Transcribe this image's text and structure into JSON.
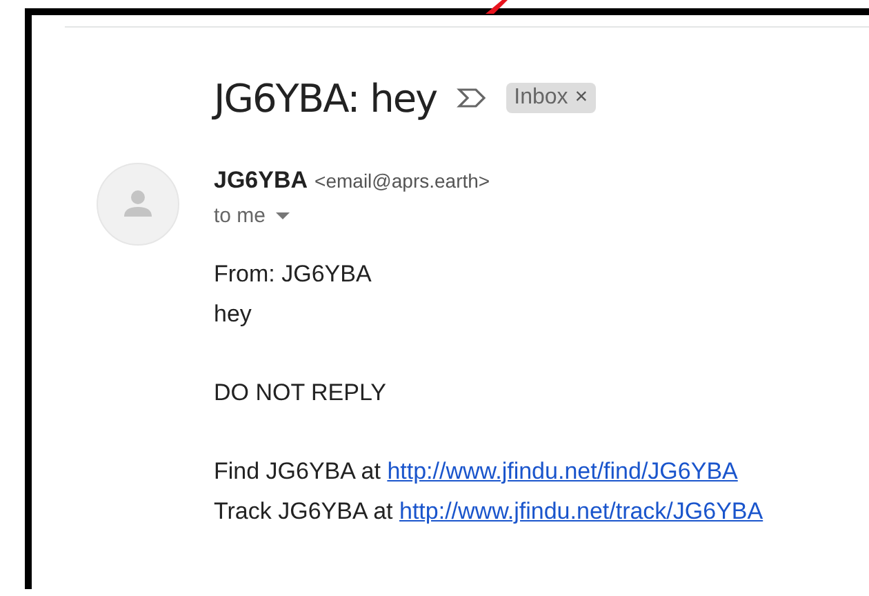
{
  "subject": "JG6YBA: hey",
  "label": {
    "text": "Inbox",
    "close": "×"
  },
  "sender": {
    "name": "JG6YBA",
    "email": "<email@aprs.earth>",
    "recipient": "to me"
  },
  "body": [
    {
      "lines": [
        {
          "text": "From: JG6YBA"
        },
        {
          "text": "hey"
        }
      ]
    },
    {
      "lines": [
        {
          "text": "DO NOT REPLY"
        }
      ]
    },
    {
      "lines": [
        {
          "text": "Find JG6YBA at ",
          "link": "http://www.jfindu.net/find/JG6YBA"
        },
        {
          "text": "Track JG6YBA at ",
          "link": "http://www.jfindu.net/track/JG6YBA"
        }
      ]
    }
  ]
}
